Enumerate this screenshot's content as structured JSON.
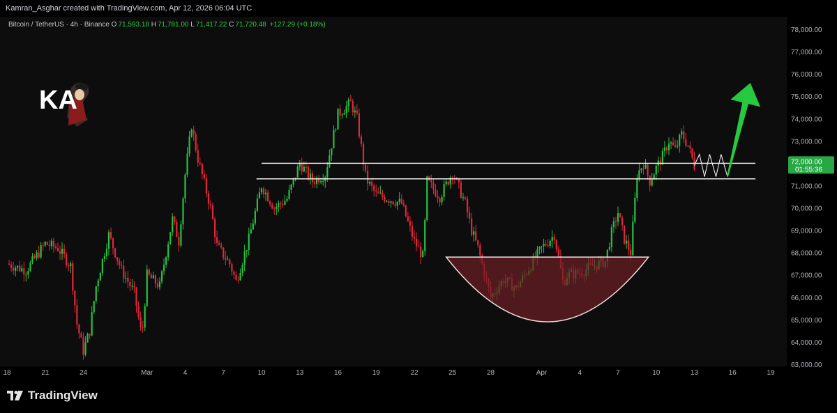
{
  "header": {
    "attribution": "Kamran_Asghar created with TradingView.com, Apr 12, 2026 06:04 UTC"
  },
  "legend": {
    "symbol": "Bitcoin / TetherUS · 4h · Binance",
    "open_label": "O",
    "open": "71,593.18",
    "high_label": "H",
    "high": "71,781.00",
    "low_label": "L",
    "low": "71,417.22",
    "close_label": "C",
    "close": "71,720.48",
    "change": "+127.29 (+0.18%)"
  },
  "price_tag": {
    "price": "72,000.00",
    "countdown": "01:55:36"
  },
  "branding": {
    "tradingview": "TradingView",
    "logo_text": "KA"
  },
  "colors": {
    "up": "#26c241",
    "down": "#e0283a",
    "background": "#0d0d0d",
    "resistance_line": "#ffffff",
    "cup_fill": "#6b1f24",
    "arrow": "#27c93f",
    "price_tag": "#28a745"
  },
  "chart_data": {
    "type": "candlestick",
    "title": "",
    "ylim": [
      63000,
      78300
    ],
    "yticks": [
      63000,
      64000,
      65000,
      66000,
      67000,
      68000,
      69000,
      70000,
      71000,
      72000,
      73000,
      74000,
      75000,
      76000,
      77000,
      78000
    ],
    "ytick_labels": [
      "63,000.00",
      "64,000.00",
      "65,000.00",
      "66,000.00",
      "67,000.00",
      "68,000.00",
      "69,000.00",
      "70,000.00",
      "71,000.00",
      "72,000.00",
      "73,000.00",
      "74,000.00",
      "75,000.00",
      "76,000.00",
      "77,000.00",
      "78,000.00"
    ],
    "xticks": [
      {
        "label": "18",
        "day": 0
      },
      {
        "label": "21",
        "day": 3
      },
      {
        "label": "24",
        "day": 6
      },
      {
        "label": "Mar",
        "day": 11
      },
      {
        "label": "4",
        "day": 14
      },
      {
        "label": "7",
        "day": 17
      },
      {
        "label": "10",
        "day": 20
      },
      {
        "label": "13",
        "day": 23
      },
      {
        "label": "16",
        "day": 26
      },
      {
        "label": "19",
        "day": 29
      },
      {
        "label": "22",
        "day": 32
      },
      {
        "label": "25",
        "day": 35
      },
      {
        "label": "28",
        "day": 38
      },
      {
        "label": "Apr",
        "day": 42
      },
      {
        "label": "4",
        "day": 45
      },
      {
        "label": "7",
        "day": 48
      },
      {
        "label": "10",
        "day": 51
      },
      {
        "label": "13",
        "day": 54
      },
      {
        "label": "16",
        "day": 57
      },
      {
        "label": "19",
        "day": 60
      }
    ],
    "price_path": [
      [
        0,
        67500
      ],
      [
        1.5,
        67200
      ],
      [
        3,
        68400
      ],
      [
        4,
        68200
      ],
      [
        5,
        67400
      ],
      [
        5.5,
        64800
      ],
      [
        6,
        63600
      ],
      [
        6.5,
        64500
      ],
      [
        7,
        66500
      ],
      [
        8,
        68800
      ],
      [
        9,
        67200
      ],
      [
        10,
        66200
      ],
      [
        10.6,
        64200
      ],
      [
        11,
        67000
      ],
      [
        12,
        66500
      ],
      [
        13,
        69500
      ],
      [
        13.5,
        68500
      ],
      [
        14,
        71500
      ],
      [
        14.5,
        73700
      ],
      [
        15,
        72200
      ],
      [
        16,
        70000
      ],
      [
        16.5,
        68300
      ],
      [
        17.5,
        67500
      ],
      [
        18,
        66700
      ],
      [
        19,
        68600
      ],
      [
        20,
        71000
      ],
      [
        21,
        70000
      ],
      [
        22,
        70400
      ],
      [
        23,
        72000
      ],
      [
        24,
        71200
      ],
      [
        25,
        71500
      ],
      [
        26,
        74200
      ],
      [
        27,
        74700
      ],
      [
        27.5,
        74000
      ],
      [
        28.2,
        71300
      ],
      [
        29,
        70600
      ],
      [
        30,
        70400
      ],
      [
        31,
        70200
      ],
      [
        32,
        68500
      ],
      [
        32.7,
        67800
      ],
      [
        33,
        71200
      ],
      [
        34,
        70500
      ],
      [
        35,
        71600
      ],
      [
        36,
        70200
      ],
      [
        36.5,
        69000
      ],
      [
        37,
        68200
      ],
      [
        38,
        66000
      ],
      [
        39,
        66800
      ],
      [
        40,
        66400
      ],
      [
        41,
        67300
      ],
      [
        42,
        68200
      ],
      [
        43,
        68800
      ],
      [
        43.7,
        66600
      ],
      [
        44,
        67000
      ],
      [
        45,
        67100
      ],
      [
        46,
        67400
      ],
      [
        47,
        67600
      ],
      [
        47.5,
        68900
      ],
      [
        48,
        69800
      ],
      [
        48.5,
        68600
      ],
      [
        49,
        68000
      ],
      [
        49.5,
        71500
      ],
      [
        50,
        72000
      ],
      [
        50.5,
        71200
      ],
      [
        51,
        71800
      ],
      [
        51.5,
        72300
      ],
      [
        52,
        73000
      ],
      [
        52.5,
        72600
      ],
      [
        53,
        73300
      ],
      [
        53.5,
        72800
      ],
      [
        54,
        71900
      ]
    ],
    "resistance_lines": [
      {
        "y": 72000,
        "x_from_day": 20,
        "x_to_day": 58.8
      },
      {
        "y": 71300,
        "x_from_day": 19.6,
        "x_to_day": 58.8
      }
    ],
    "cup": {
      "rim_y": 67800,
      "bottom_y": 64900,
      "x_from_day": 34.5,
      "x_to_day": 50.4
    },
    "zigzag": [
      [
        54,
        71900
      ],
      [
        54.4,
        72400
      ],
      [
        54.8,
        71400
      ],
      [
        55.2,
        72400
      ],
      [
        55.7,
        71400
      ],
      [
        56.1,
        72400
      ],
      [
        56.6,
        71400
      ]
    ],
    "arrow": {
      "from": [
        56.6,
        71400
      ],
      "to": [
        58.4,
        75600
      ]
    },
    "current_price": 72000
  }
}
